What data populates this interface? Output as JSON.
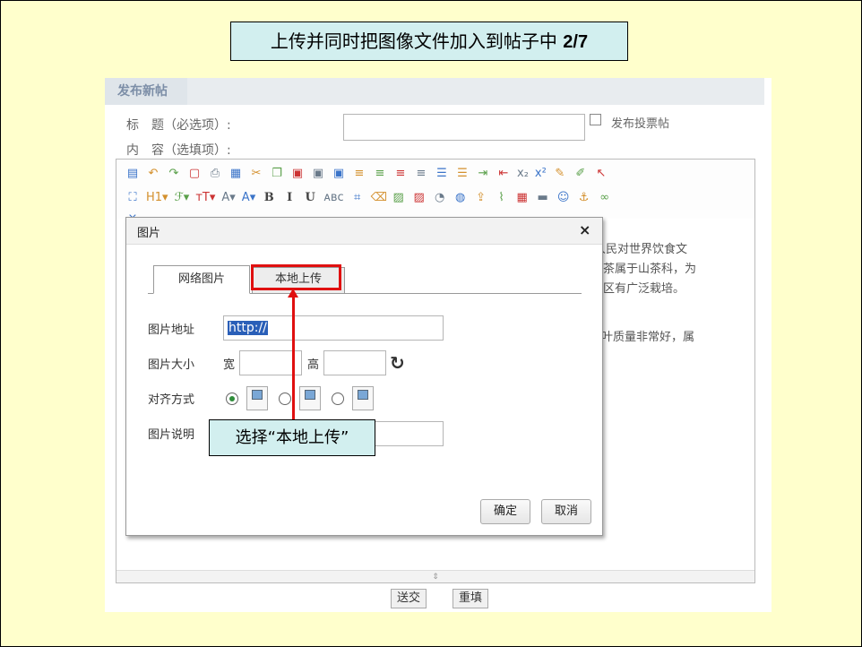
{
  "slide": {
    "title": "上传并同时把图像文件加入到帖子中 ",
    "title_step": "2/7"
  },
  "panel": {
    "tab": "发布新帖",
    "title_label": "标　题（必选项）:",
    "content_label": "内　容（选填项）:",
    "vote_label": "发布投票帖",
    "submit_label": "送交",
    "reset_label": "重填"
  },
  "toolbar": {
    "row1": [
      {
        "name": "source-icon",
        "glyph": "▤"
      },
      {
        "name": "undo-icon",
        "glyph": "↶"
      },
      {
        "name": "redo-icon",
        "glyph": "↷"
      },
      {
        "name": "preview-icon",
        "glyph": "▢"
      },
      {
        "name": "print-icon",
        "glyph": "⎙"
      },
      {
        "name": "template-icon",
        "glyph": "▦"
      },
      {
        "name": "cut-icon",
        "glyph": "✂"
      },
      {
        "name": "copy-icon",
        "glyph": "❐"
      },
      {
        "name": "paste-icon",
        "glyph": "▣"
      },
      {
        "name": "paste-text-icon",
        "glyph": "▣"
      },
      {
        "name": "paste-word-icon",
        "glyph": "▣"
      },
      {
        "name": "align-left-icon",
        "glyph": "≡"
      },
      {
        "name": "align-center-icon",
        "glyph": "≡"
      },
      {
        "name": "align-right-icon",
        "glyph": "≡"
      },
      {
        "name": "justify-icon",
        "glyph": "≡"
      },
      {
        "name": "ordered-list-icon",
        "glyph": "☰"
      },
      {
        "name": "unordered-list-icon",
        "glyph": "☰"
      },
      {
        "name": "indent-icon",
        "glyph": "⇥"
      },
      {
        "name": "outdent-icon",
        "glyph": "⇤"
      },
      {
        "name": "subscript-icon",
        "glyph": "x₂"
      },
      {
        "name": "superscript-icon",
        "glyph": "x²"
      },
      {
        "name": "clear-format-icon",
        "glyph": "✎"
      },
      {
        "name": "select-all-icon",
        "glyph": "✐"
      },
      {
        "name": "cursor-icon",
        "glyph": "↖"
      }
    ],
    "row2": [
      {
        "name": "fullscreen-icon",
        "glyph": "⛶"
      },
      {
        "name": "heading-icon",
        "glyph": "H1▾"
      },
      {
        "name": "font-family-icon",
        "glyph": "ℱ▾"
      },
      {
        "name": "font-size-icon",
        "glyph": "тT▾"
      },
      {
        "name": "font-color-icon",
        "glyph": "A▾"
      },
      {
        "name": "highlight-icon",
        "glyph": "A▾"
      },
      {
        "name": "bold-icon",
        "glyph": "B"
      },
      {
        "name": "italic-icon",
        "glyph": "I"
      },
      {
        "name": "underline-icon",
        "glyph": "U"
      },
      {
        "name": "strikethrough-icon",
        "glyph": "ᴀʙᴄ"
      },
      {
        "name": "special-chars-icon",
        "glyph": "⌗"
      },
      {
        "name": "eraser-icon",
        "glyph": "⌫"
      },
      {
        "name": "image-icon",
        "glyph": "▨"
      },
      {
        "name": "multi-image-icon",
        "glyph": "▨"
      },
      {
        "name": "flash-icon",
        "glyph": "◔"
      },
      {
        "name": "media-icon",
        "glyph": "◍"
      },
      {
        "name": "upload-icon",
        "glyph": "⇪"
      },
      {
        "name": "attachment-icon",
        "glyph": "⌇"
      },
      {
        "name": "table-icon",
        "glyph": "▦"
      },
      {
        "name": "horizontal-rule-icon",
        "glyph": "▬"
      },
      {
        "name": "emoticon-icon",
        "glyph": "☺"
      },
      {
        "name": "anchor-icon",
        "glyph": "⚓"
      },
      {
        "name": "link-icon",
        "glyph": "∞"
      }
    ],
    "row3": [
      {
        "name": "unlink-icon",
        "glyph": "⨯"
      }
    ]
  },
  "editor": {
    "text": [
      "国人民对世界饮食文",
      "。茶属于山茶科，为",
      "地区有广泛栽培。",
      "茶叶质量非常好，属"
    ],
    "footer": "⇕"
  },
  "dialog": {
    "title": "图片",
    "close": "×",
    "tabs": [
      "网络图片",
      "本地上传"
    ],
    "url_label": "图片地址",
    "url_value": "http://",
    "size_label": "图片大小",
    "width_label": "宽",
    "height_label": "高",
    "align_label": "对齐方式",
    "desc_label": "图片说明",
    "ok_label": "确定",
    "cancel_label": "取消"
  },
  "annotation": {
    "callout": "选择“本地上传”",
    "color": "#e01010"
  }
}
